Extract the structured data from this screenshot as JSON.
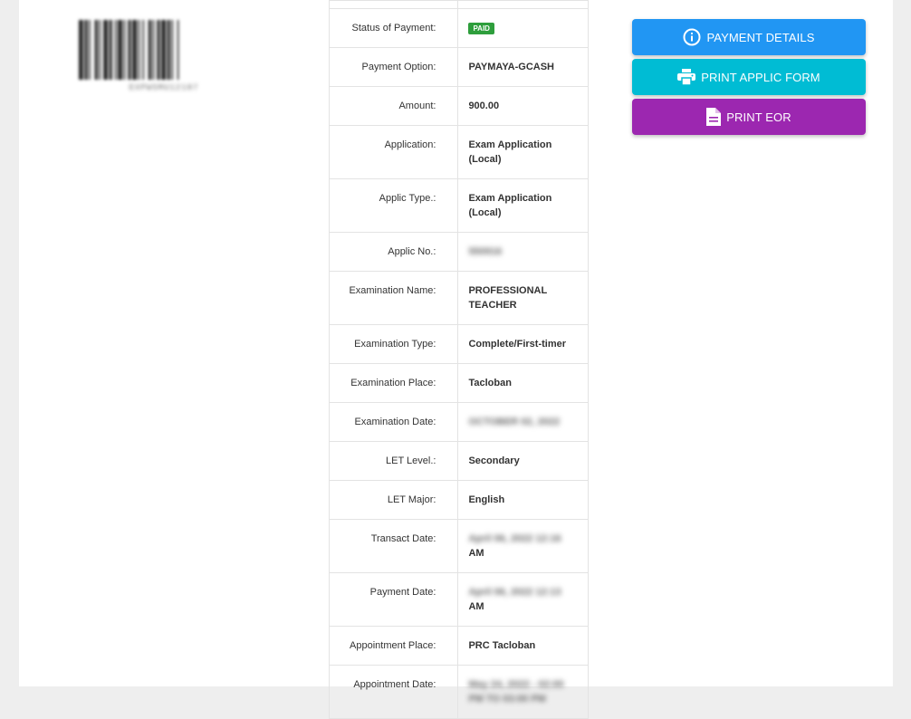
{
  "barcode": {
    "number": "EXPWSMU12187"
  },
  "details": {
    "rows": [
      {
        "label": "Status of Payment:",
        "value": "PAID",
        "kind": "badge"
      },
      {
        "label": "Payment Option:",
        "value": "PAYMAYA-GCASH"
      },
      {
        "label": "Amount:",
        "value": "900.00"
      },
      {
        "label": "Application:",
        "value": "Exam Application (Local)"
      },
      {
        "label": "Applic Type.:",
        "value": "Exam Application (Local)"
      },
      {
        "label": "Applic No.:",
        "value": "550916",
        "kind": "blur"
      },
      {
        "label": "Examination Name:",
        "value": "PROFESSIONAL TEACHER"
      },
      {
        "label": "Examination Type:",
        "value": "Complete/First-timer"
      },
      {
        "label": "Examination Place:",
        "value": "Tacloban"
      },
      {
        "label": "Examination Date:",
        "value": "OCTOBER 02, 2022",
        "kind": "blur"
      },
      {
        "label": "LET Level.:",
        "value": "Secondary"
      },
      {
        "label": "LET Major:",
        "value": "English"
      },
      {
        "label": "Transact Date:",
        "value": "April 06, 2022 12:16",
        "suffix": "AM",
        "kind": "blur-suffix"
      },
      {
        "label": "Payment Date:",
        "value": "April 06, 2022 12:13",
        "suffix": "AM",
        "kind": "blur-suffix"
      },
      {
        "label": "Appointment Place:",
        "value": "PRC Tacloban"
      },
      {
        "label": "Appointment Date:",
        "value": "May 24, 2022 - 02:00 PM TO 03:00 PM",
        "kind": "blur"
      }
    ]
  },
  "buttons": {
    "payment_details": "PAYMENT DETAILS",
    "print_applic_form": "PRINT APPLIC FORM",
    "print_eor": "PRINT EOR"
  },
  "colors": {
    "paid_badge": "#2e9e3c",
    "payment_details": "#2196f3",
    "print_applic_form": "#00bcd4",
    "print_eor": "#9c27b0"
  },
  "icons": {
    "payment_details": "info-icon",
    "print_applic_form": "printer-icon",
    "print_eor": "document-icon"
  }
}
